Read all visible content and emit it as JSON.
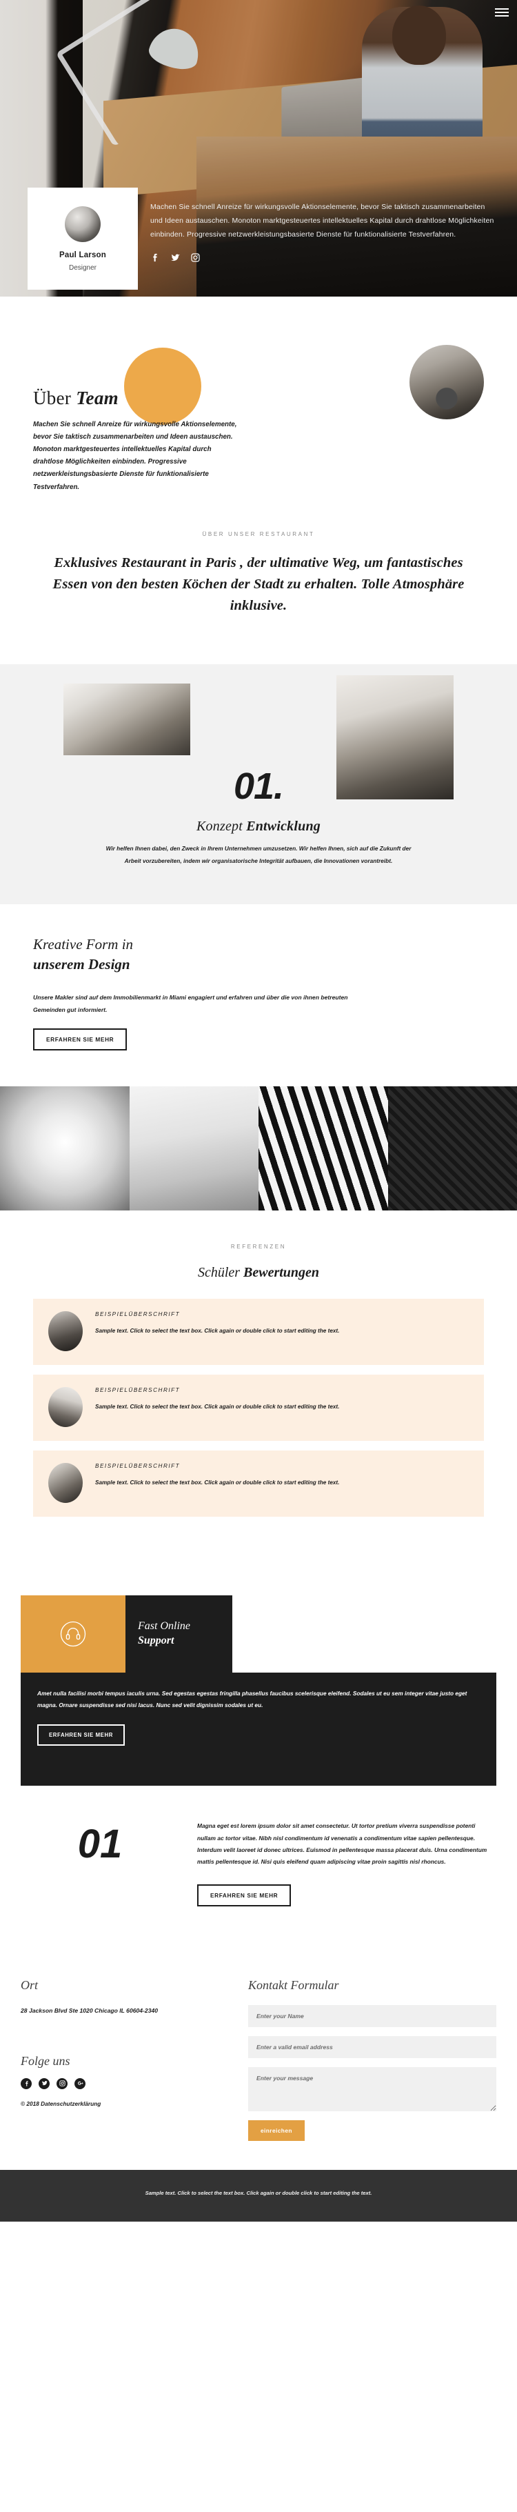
{
  "hero": {
    "menu_icon": "hamburger-icon",
    "card": {
      "name": "Paul Larson",
      "role": "Designer"
    },
    "paragraph": "Machen Sie schnell Anreize für wirkungsvolle Aktionselemente, bevor Sie taktisch zusammenarbeiten und Ideen austauschen. Monoton marktgesteuertes intellektuelles Kapital durch drahtlose Möglichkeiten einbinden. Progressive netzwerkleistungsbasierte Dienste für funktionalisierte Testverfahren.",
    "social": [
      {
        "name": "facebook-icon",
        "label": "Facebook"
      },
      {
        "name": "twitter-icon",
        "label": "Twitter"
      },
      {
        "name": "instagram-icon",
        "label": "Instagram"
      }
    ]
  },
  "about": {
    "title_plain": "Über ",
    "title_bold": "Team",
    "paragraph": "Machen Sie schnell Anreize für wirkungsvolle Aktionselemente, bevor Sie taktisch zusammenarbeiten und Ideen austauschen. Monoton marktgesteuertes intellektuelles Kapital durch drahtlose Möglichkeiten einbinden. Progressive netzwerkleistungsbasierte Dienste für funktionalisierte Testverfahren."
  },
  "restaurant": {
    "eyebrow": "ÜBER UNSER RESTAURANT",
    "heading": "Exklusives Restaurant in Paris , der ultimative Weg, um fantastisches Essen von den besten Köchen der Stadt zu erhalten. Tolle Atmosphäre inklusive."
  },
  "konzept": {
    "number": "01.",
    "title_plain": "Konzept ",
    "title_bold": "Entwicklung",
    "paragraph": "Wir helfen Ihnen dabei, den Zweck in Ihrem Unternehmen umzusetzen. Wir helfen Ihnen, sich auf die Zukunft der Arbeit vorzubereiten, indem wir organisatorische Integrität aufbauen, die Innovationen vorantreibt."
  },
  "kreativ": {
    "title_line1": "Kreative Form in",
    "title_line2": "unserem Design",
    "paragraph": "Unsere Makler sind auf dem Immobilienmarkt in Miami engagiert und erfahren und über die von ihnen betreuten Gemeinden gut informiert.",
    "button": "ERFAHREN SIE MEHR"
  },
  "reviews": {
    "eyebrow": "REFERENZEN",
    "title_plain": "Schüler ",
    "title_bold": "Bewertungen",
    "items": [
      {
        "heading": "BEISPIELÜBERSCHRIFT",
        "body": "Sample text. Click to select the text box. Click again or double click to start editing the text."
      },
      {
        "heading": "BEISPIELÜBERSCHRIFT",
        "body": "Sample text. Click to select the text box. Click again or double click to start editing the text."
      },
      {
        "heading": "BEISPIELÜBERSCHRIFT",
        "body": "Sample text. Click to select the text box. Click again or double click to start editing the text."
      }
    ]
  },
  "support": {
    "icon": "headset-icon",
    "title_line1": "Fast Online",
    "title_line2": "Support",
    "paragraph": "Amet nulla facilisi morbi tempus iaculis urna. Sed egestas egestas fringilla phasellus faucibus scelerisque eleifend. Sodales ut eu sem integer vitae justo eget magna. Ornare suspendisse sed nisi lacus. Nunc sed velit dignissim sodales ut eu.",
    "button": "ERFAHREN SIE MEHR"
  },
  "lorem": {
    "number": "01",
    "paragraph": "Magna eget est lorem ipsum dolor sit amet consectetur. Ut tortor pretium viverra suspendisse potenti nullam ac tortor vitae. Nibh nisl condimentum id venenatis a condimentum vitae sapien pellentesque. Interdum velit laoreet id donec ultrices. Euismod in pellentesque massa placerat duis. Urna condimentum mattis pellentesque id. Nisi quis eleifend quam adipiscing vitae proin sagittis nisl rhoncus.",
    "button": "ERFAHREN SIE MEHR"
  },
  "footer": {
    "location_title": "Ort",
    "address": "28 Jackson Blvd Ste 1020 Chicago IL 60604-2340",
    "follow_title": "Folge uns",
    "social": [
      {
        "name": "facebook-icon",
        "label": "Facebook"
      },
      {
        "name": "twitter-icon",
        "label": "Twitter"
      },
      {
        "name": "instagram-icon",
        "label": "Instagram"
      },
      {
        "name": "google-plus-icon",
        "label": "Google Plus"
      }
    ],
    "copyright": "© 2018 Datenschutzerklärung",
    "form": {
      "title": "Kontakt Formular",
      "name_placeholder": "Enter your Name",
      "email_placeholder": "Enter a valid email address",
      "message_placeholder": "Enter your message",
      "submit_label": "einreichen"
    }
  },
  "bottombar": {
    "text": "Sample text. Click to select the text box. Click again or double click to start editing the text."
  },
  "colors": {
    "accent_orange": "#e3a043",
    "circle_orange": "#eda94a",
    "dark": "#1d1d1d",
    "review_bg": "#fdefe1",
    "bottombar_bg": "#333333",
    "section_grey": "#f2f2f2"
  }
}
